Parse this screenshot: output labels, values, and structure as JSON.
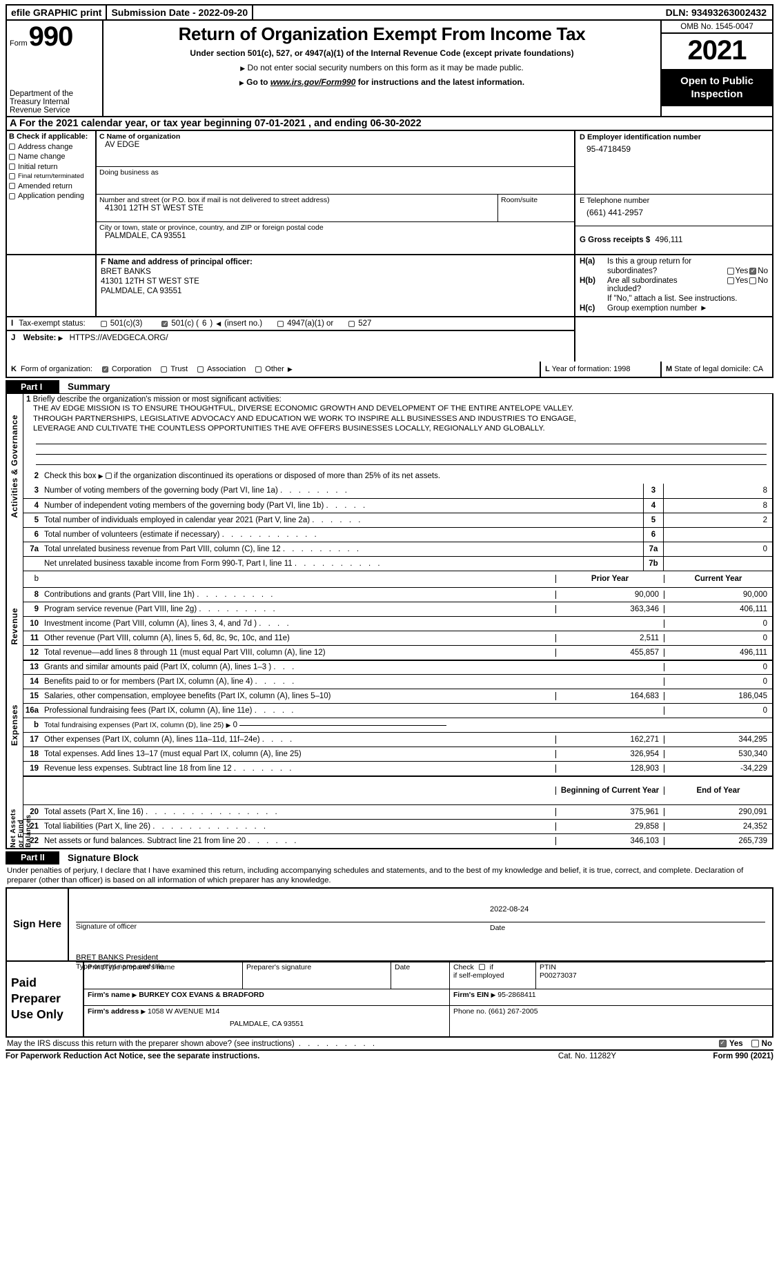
{
  "efile": {
    "graphic_print": "efile GRAPHIC print",
    "submission": "Submission Date - 2022-09-20",
    "dln": "DLN: 93493263002432"
  },
  "masthead": {
    "form_label": "Form",
    "form_number": "990",
    "title": "Return of Organization Exempt From Income Tax",
    "subtitle": "Under section 501(c), 527, or 4947(a)(1) of the Internal Revenue Code (except private foundations)",
    "note1": "Do not enter social security numbers on this form as it may be made public.",
    "note2_pre": "Go to",
    "note2_url": "www.irs.gov/Form990",
    "note2_post": "for instructions and the latest information.",
    "department": "Department of the Treasury Internal Revenue Service",
    "omb": "OMB No. 1545-0047",
    "year": "2021",
    "open_to_public": "Open to Public Inspection"
  },
  "line_a": "A For the 2021 calendar year, or tax year beginning 07-01-2021   , and ending 06-30-2022",
  "section_b": {
    "header": "B  Check if applicable:",
    "items": [
      {
        "label": "Address change",
        "checked": false
      },
      {
        "label": "Name change",
        "checked": false
      },
      {
        "label": "Initial return",
        "checked": false
      },
      {
        "label": "Final return/terminated",
        "checked": false
      },
      {
        "label": "Amended return",
        "checked": false
      },
      {
        "label": "Application pending",
        "checked": false
      }
    ]
  },
  "section_c": {
    "name_label": "C Name of organization",
    "name_value": "AV EDGE",
    "dba_label": "Doing business as",
    "dba_value": "",
    "street_label": "Number and street (or P.O. box if mail is not delivered to street address)",
    "street_value": "41301 12TH ST WEST STE",
    "room_label": "Room/suite",
    "room_value": "",
    "city_label": "City or town, state or province, country, and ZIP or foreign postal code",
    "city_value": "PALMDALE, CA   93551"
  },
  "section_d": {
    "ein_label": "D Employer identification number",
    "ein_value": "95-4718459",
    "phone_label": "E Telephone number",
    "phone_value": "(661) 441-2957",
    "gross_label": "G Gross receipts $",
    "gross_value": "496,111"
  },
  "section_f": {
    "label": "F  Name and address of principal officer:",
    "name": "BRET BANKS",
    "street": "41301 12TH ST WEST STE",
    "city": "PALMDALE, CA   93551"
  },
  "section_h": {
    "ha_label": "H(a)",
    "ha_text1": "Is this a group return for",
    "ha_text2": "subordinates?",
    "ha_yes": "Yes",
    "ha_no": "No",
    "ha_yes_checked": false,
    "ha_no_checked": true,
    "hb_label": "H(b)",
    "hb_text1": "Are all subordinates",
    "hb_text2": "included?",
    "hb_yes": "Yes",
    "hb_no": "No",
    "hb_yes_checked": false,
    "hb_no_checked": false,
    "hb_note": "If \"No,\" attach a list. See instructions.",
    "hc_label": "H(c)",
    "hc_text": "Group exemption number"
  },
  "section_i": {
    "label": "I",
    "text": "Tax-exempt status:",
    "opt1": "501(c)(3)",
    "opt1_checked": false,
    "opt2_a": "501(c) (",
    "opt2_no": "6",
    "opt2_b": ")",
    "opt2_insert": "(insert no.)",
    "opt2_checked": true,
    "opt3": "4947(a)(1) or",
    "opt3_checked": false,
    "opt4": "527",
    "opt4_checked": false
  },
  "section_j": {
    "label": "J",
    "title": "Website:",
    "value": "HTTPS://AVEDGECA.ORG/"
  },
  "section_k": {
    "label": "K",
    "text": "Form of organization:",
    "opts": [
      {
        "label": "Corporation",
        "checked": true
      },
      {
        "label": "Trust",
        "checked": false
      },
      {
        "label": "Association",
        "checked": false
      },
      {
        "label": "Other",
        "checked": false
      }
    ],
    "l_label": "L",
    "l_text": "Year of formation: 1998",
    "m_label": "M",
    "m_text": "State of legal domicile: CA"
  },
  "part1": {
    "part_no": "Part I",
    "part_title": "Summary",
    "side_tab_activities": "Activities & Governance",
    "side_tab_revenue": "Revenue",
    "side_tab_expenses": "Expenses",
    "side_tab_netassets": "Net Assets or Fund Balances",
    "line1_num": "1",
    "line1_label": "Briefly describe the organization's mission or most significant activities:",
    "mission": [
      "THE AV EDGE MISSION IS TO ENSURE THOUGHTFUL, DIVERSE ECONOMIC GROWTH AND DEVELOPMENT OF THE ENTIRE ANTELOPE VALLEY.",
      "THROUGH PARTNERSHIPS, LEGISLATIVE ADVOCACY AND EDUCATION WE WORK TO INSPIRE ALL BUSINESSES AND INDUSTRIES TO ENGAGE,",
      "LEVERAGE AND CULTIVATE THE COUNTLESS OPPORTUNITIES THE AVE OFFERS BUSINESSES LOCALLY, REGIONALLY AND GLOBALLY."
    ],
    "line2_num": "2",
    "line2_text": "Check this box",
    "line2_text2": "if the organization discontinued its operations or disposed of more than 25% of its net assets.",
    "gov_rows": [
      {
        "num": "3",
        "text": "Number of voting members of the governing body (Part VI, line 1a)",
        "dots": ". . . . . . . .",
        "box": "3",
        "value": "8"
      },
      {
        "num": "4",
        "text": "Number of independent voting members of the governing body (Part VI, line 1b)",
        "dots": ". . . . .",
        "box": "4",
        "value": "8"
      },
      {
        "num": "5",
        "text": "Total number of individuals employed in calendar year 2021 (Part V, line 2a)",
        "dots": ". . . . . .",
        "box": "5",
        "value": "2"
      },
      {
        "num": "6",
        "text": "Total number of volunteers (estimate if necessary)",
        "dots": ". . . . . . . . . . .",
        "box": "6",
        "value": ""
      },
      {
        "num": "7a",
        "text": "Total unrelated business revenue from Part VIII, column (C), line 12",
        "dots": ". . . . . . . . .",
        "box": "7a",
        "value": "0"
      },
      {
        "num": "",
        "text": "Net unrelated business taxable income from Form 990-T, Part I, line 11",
        "dots": ". . . . . . . . . .",
        "box": "7b",
        "value": ""
      }
    ],
    "rev_hdr_b": "b",
    "rev_hdr_prior": "Prior Year",
    "rev_hdr_current": "Current Year",
    "revenue_rows": [
      {
        "num": "8",
        "text": "Contributions and grants (Part VIII, line 1h)",
        "dots": ". . . . . . . . .",
        "prior": "90,000",
        "current": "90,000"
      },
      {
        "num": "9",
        "text": "Program service revenue (Part VIII, line 2g)",
        "dots": ". . . . . . . . .",
        "prior": "363,346",
        "current": "406,111"
      },
      {
        "num": "10",
        "text": "Investment income (Part VIII, column (A), lines 3, 4, and 7d )",
        "dots": ". . . .",
        "prior": "",
        "current": "0"
      },
      {
        "num": "11",
        "text": "Other revenue (Part VIII, column (A), lines 5, 6d, 8c, 9c, 10c, and 11e)",
        "dots": "",
        "prior": "2,511",
        "current": "0"
      },
      {
        "num": "12",
        "text": "Total revenue—add lines 8 through 11 (must equal Part VIII, column (A), line 12)",
        "dots": "",
        "prior": "455,857",
        "current": "496,111"
      }
    ],
    "expense_rows": [
      {
        "num": "13",
        "text": "Grants and similar amounts paid (Part IX, column (A), lines 1–3 )",
        "dots": ". . .",
        "prior": "",
        "current": "0",
        "shaded": false
      },
      {
        "num": "14",
        "text": "Benefits paid to or for members (Part IX, column (A), line 4)",
        "dots": ". . . . .",
        "prior": "",
        "current": "0",
        "shaded": false
      },
      {
        "num": "15",
        "text": "Salaries, other compensation, employee benefits (Part IX, column (A), lines 5–10)",
        "dots": "",
        "prior": "164,683",
        "current": "186,045",
        "shaded": false
      },
      {
        "num": "16a",
        "text": "Professional fundraising fees (Part IX, column (A), line 11e)",
        "dots": ". . . . .",
        "prior": "",
        "current": "0",
        "shaded": false
      },
      {
        "num": "b",
        "text": "Total fundraising expenses (Part IX, column (D), line 25)",
        "dots": "",
        "prior": "",
        "current": "",
        "shaded": true,
        "suffix": "0"
      },
      {
        "num": "17",
        "text": "Other expenses (Part IX, column (A), lines 11a–11d, 11f–24e)",
        "dots": ". . . .",
        "prior": "162,271",
        "current": "344,295",
        "shaded": false
      },
      {
        "num": "18",
        "text": "Total expenses. Add lines 13–17 (must equal Part IX, column (A), line 25)",
        "dots": "",
        "prior": "326,954",
        "current": "530,340",
        "shaded": false
      },
      {
        "num": "19",
        "text": "Revenue less expenses. Subtract line 18 from line 12",
        "dots": ". . . . . . .",
        "prior": "128,903",
        "current": "-34,229",
        "shaded": false
      }
    ],
    "na_hdr_begin": "Beginning of Current Year",
    "na_hdr_end": "End of Year",
    "netassets_rows": [
      {
        "num": "20",
        "text": "Total assets (Part X, line 16)",
        "dots": ". . . . . . . . . . . . . . .",
        "begin": "375,961",
        "end": "290,091"
      },
      {
        "num": "21",
        "text": "Total liabilities (Part X, line 26)",
        "dots": ". . . . . . . . . . . . .",
        "begin": "29,858",
        "end": "24,352"
      },
      {
        "num": "22",
        "text": "Net assets or fund balances. Subtract line 21 from line 20",
        "dots": ". . . . . .",
        "begin": "346,103",
        "end": "265,739"
      }
    ]
  },
  "part2": {
    "part_no": "Part II",
    "part_title": "Signature Block",
    "perjury": "Under penalties of perjury, I declare that I have examined this return, including accompanying schedules and statements, and to the best of my knowledge and belief, it is true, correct, and complete. Declaration of preparer (other than officer) is based on all information of which preparer has any knowledge.",
    "sign_here": "Sign Here",
    "sig_officer_cap": "Signature of officer",
    "sig_date_value": "2022-08-24",
    "sig_date_cap": "Date",
    "printed_name": "BRET BANKS  President",
    "printed_name_cap": "Type or print name and title"
  },
  "preparer": {
    "label": "Paid Preparer Use Only",
    "hdr_name": "Print/Type preparer's name",
    "hdr_sig": "Preparer's signature",
    "hdr_date": "Date",
    "hdr_check": "Check",
    "hdr_check2": "if self-employed",
    "hdr_ptin": "PTIN",
    "ptin_value": "P00273037",
    "check_checked": false,
    "firm_name_label": "Firm's name",
    "firm_name_value": "BURKEY COX EVANS & BRADFORD",
    "firm_ein_label": "Firm's EIN",
    "firm_ein_value": "95-2868411",
    "firm_addr_label": "Firm's address",
    "firm_addr_value": "1058 W AVENUE M14",
    "firm_addr_city": "PALMDALE, CA   93551",
    "phone_label": "Phone no.",
    "phone_value": "(661) 267-2005"
  },
  "footer": {
    "discuss": "May the IRS discuss this return with the preparer shown above? (see instructions)",
    "dots": ". . . . . . . . .",
    "yes": "Yes",
    "no": "No",
    "yes_checked": true,
    "no_checked": false,
    "paperwork": "For Paperwork Reduction Act Notice, see the separate instructions.",
    "catalog": "Cat. No. 11282Y",
    "formref": "Form 990 (2021)"
  }
}
